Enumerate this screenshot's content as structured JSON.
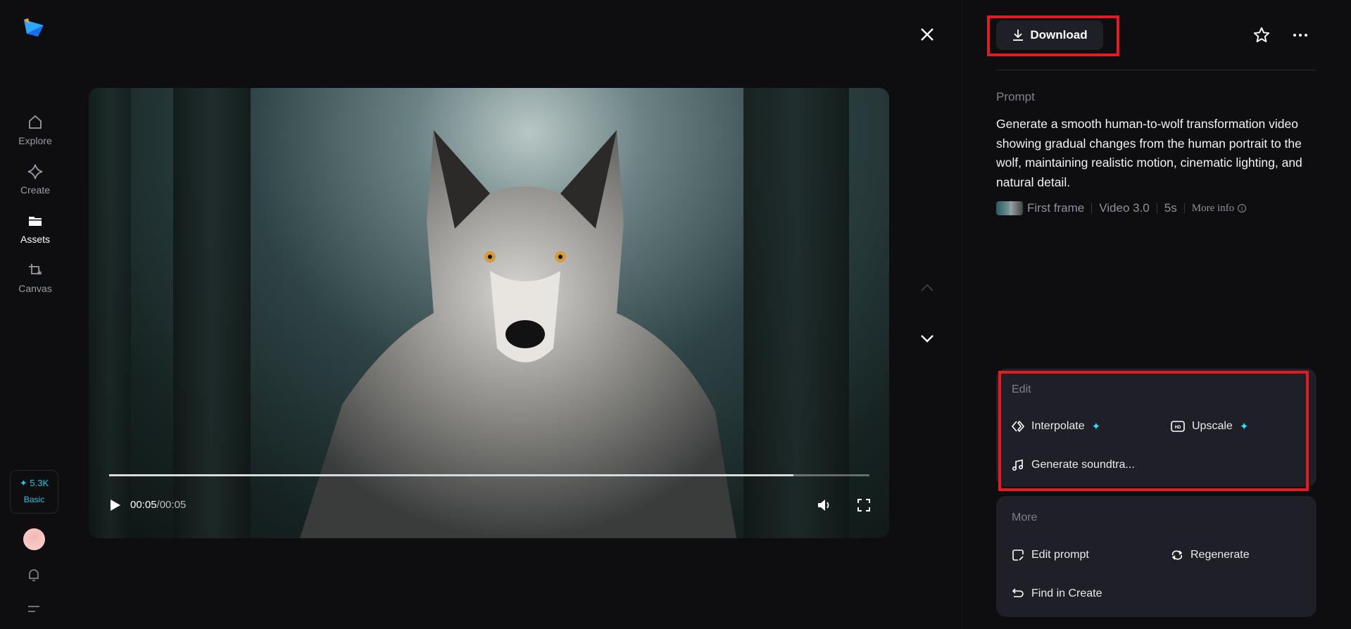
{
  "sidebar": {
    "items": [
      {
        "label": "Explore",
        "icon": "home-icon"
      },
      {
        "label": "Create",
        "icon": "diamond-icon"
      },
      {
        "label": "Assets",
        "icon": "folder-icon",
        "active": true
      },
      {
        "label": "Canvas",
        "icon": "crop-icon"
      }
    ],
    "credits": {
      "amount": "5.3K",
      "plan": "Basic"
    }
  },
  "player": {
    "current_time": "00:05",
    "separator": "/",
    "duration": "00:05",
    "progress": 0.9
  },
  "header": {
    "download_label": "Download"
  },
  "prompt": {
    "label": "Prompt",
    "text": "Generate a smooth human-to-wolf transformation video showing gradual changes from the human portrait to the wolf, maintaining realistic motion, cinematic lighting, and natural detail.",
    "first_frame": "First frame",
    "model": "Video 3.0",
    "duration": "5s",
    "more_info": "More info"
  },
  "edit": {
    "title": "Edit",
    "items": [
      {
        "label": "Interpolate"
      },
      {
        "label": "Upscale"
      },
      {
        "label": "Generate soundtra..."
      }
    ]
  },
  "more": {
    "title": "More",
    "items": [
      {
        "label": "Edit prompt"
      },
      {
        "label": "Regenerate"
      },
      {
        "label": "Find in Create"
      }
    ]
  },
  "colors": {
    "accent": "#2fe1ff",
    "highlight": "#e51b24",
    "card": "#1f2027",
    "bg": "#0e0e11"
  }
}
